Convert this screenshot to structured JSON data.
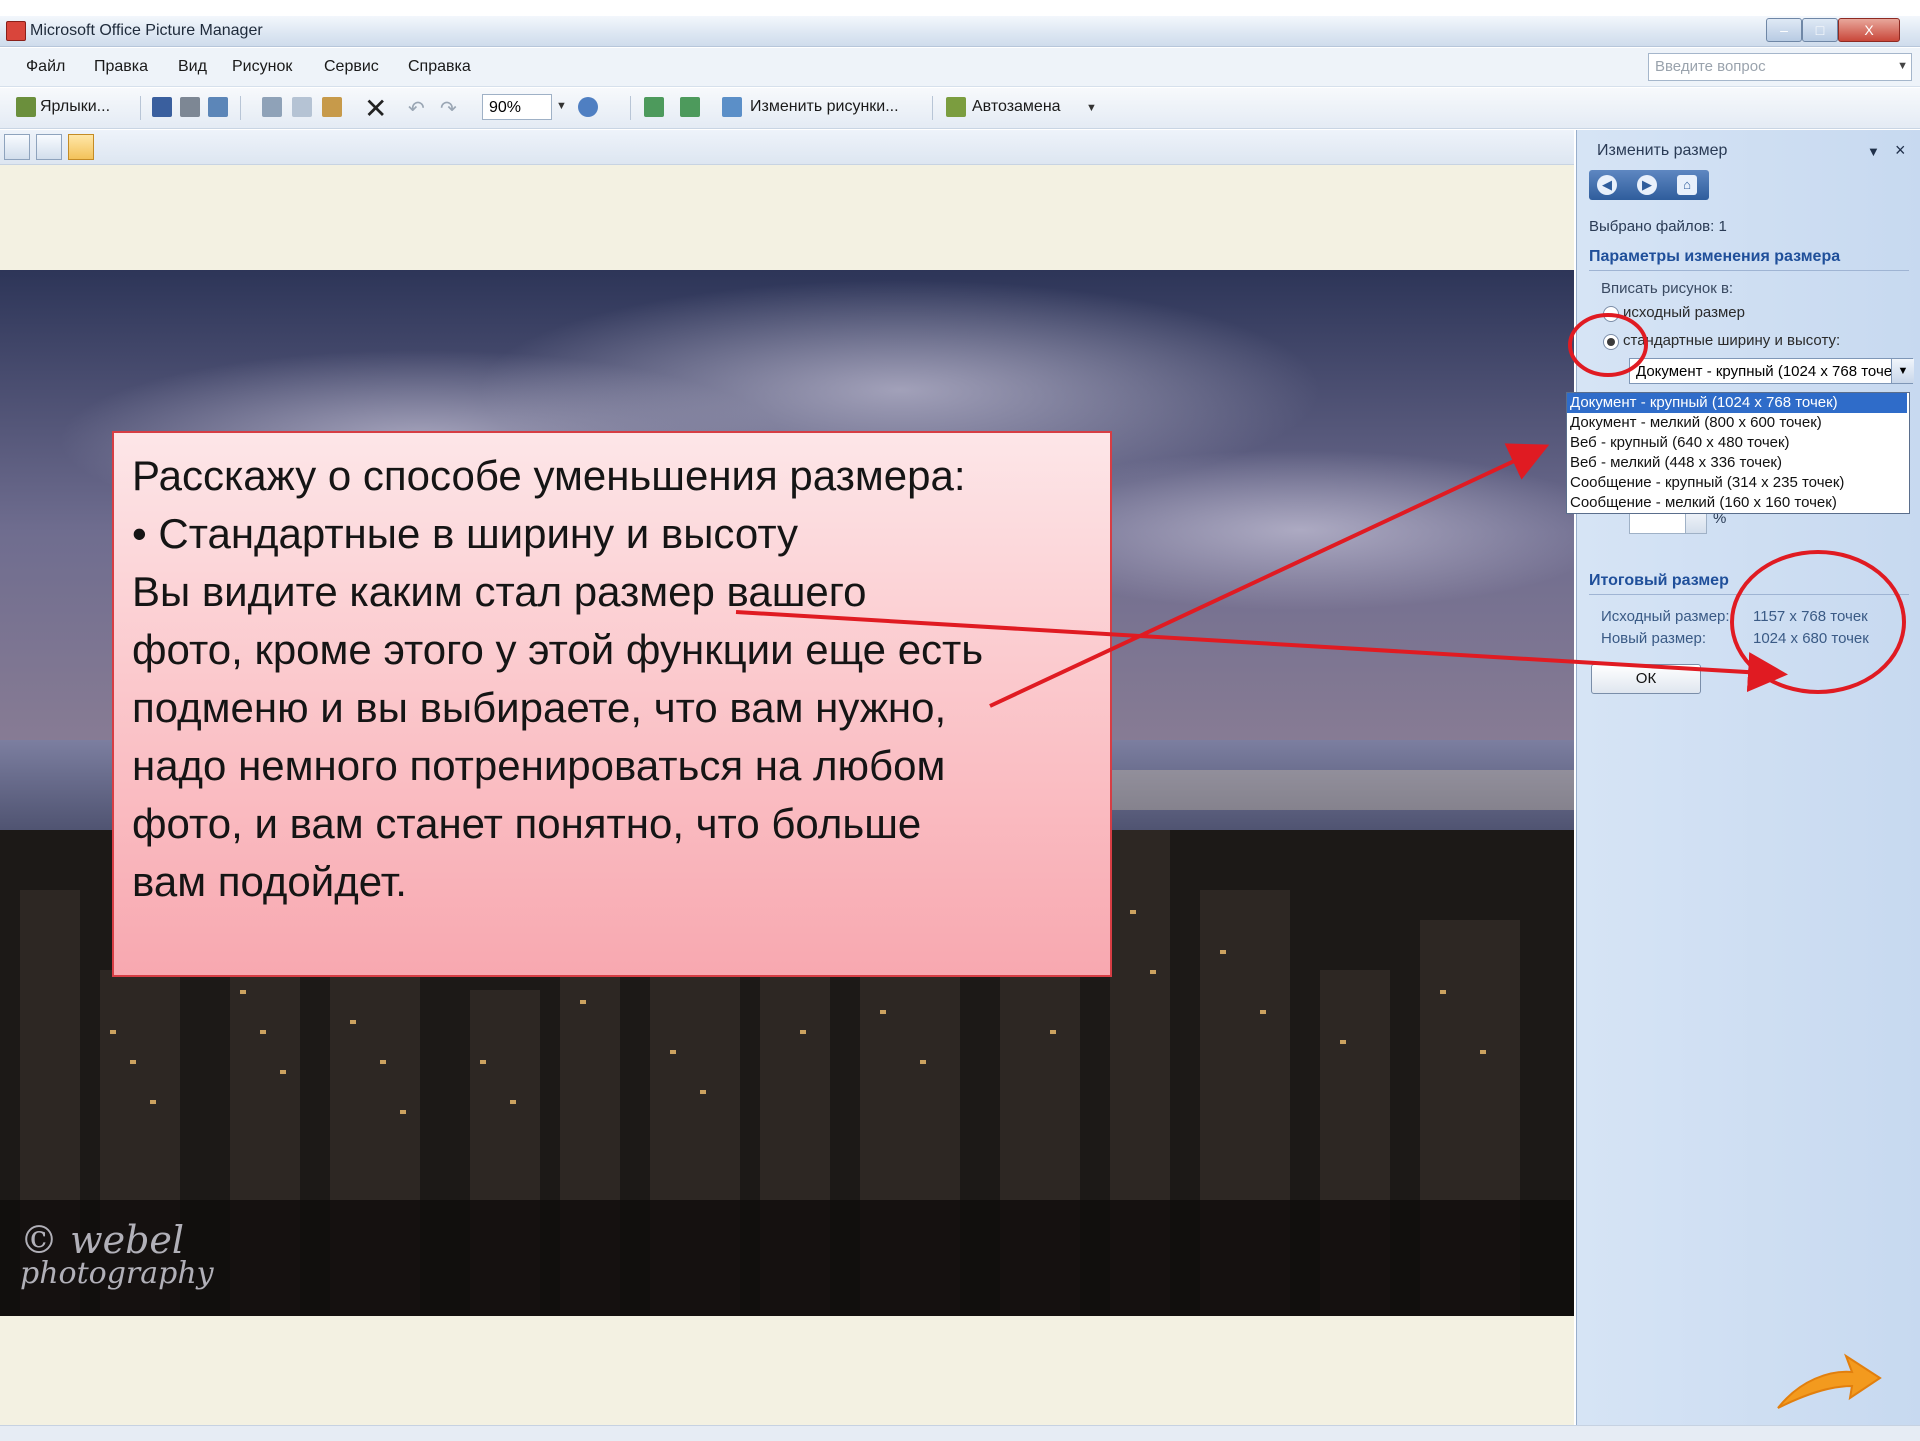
{
  "window": {
    "title": "Microsoft Office Picture Manager",
    "min_glyph": "–",
    "max_glyph": "□",
    "close_glyph": "X"
  },
  "menu": {
    "items": [
      "Файл",
      "Правка",
      "Вид",
      "Рисунок",
      "Сервис",
      "Справка"
    ],
    "help_placeholder": "Введите вопрос"
  },
  "toolbar": {
    "shortcuts_label": "Ярлыки...",
    "zoom_value": "90%",
    "edit_pictures_label": "Изменить рисунки...",
    "autocorrect_label": "Автозамена"
  },
  "callout": {
    "lines": [
      "Расскажу о  способе уменьшения размера:",
      "• Стандартные в ширину и высоту",
      "Вы видите каким стал размер вашего",
      "фото, кроме этого у этой функции еще есть",
      "подменю и вы выбираете, что вам нужно,",
      "надо немного потренироваться на любом",
      "фото, и вам станет понятно, что больше",
      "вам подойдет."
    ]
  },
  "watermark": {
    "line1": "© webel",
    "line2": "photography"
  },
  "pane": {
    "title": "Изменить размер",
    "dropdown_glyph": "▼",
    "close_glyph": "×",
    "files_selected": "Выбрано файлов: 1",
    "section_title": "Параметры изменения размера",
    "fit_label": "Вписать рисунок в:",
    "option_original": "исходный размер",
    "option_standard": "стандартные ширину и высоту:",
    "selected_size": "Документ - крупный (1024 x 768 точек)",
    "size_options": [
      "Документ - крупный (1024 x 768 точек)",
      "Документ - мелкий (800 x 600 точек)",
      "Веб - крупный (640 x 480 точек)",
      "Веб - мелкий (448 x 336 точек)",
      "Сообщение - крупный (314 x 235 точек)",
      "Сообщение - мелкий (160 x 160 точек)"
    ],
    "percent_sign": "%",
    "summary_title": "Итоговый размер",
    "original_label": "Исходный размер:",
    "original_value": "1157 x 768 точек",
    "new_label": "Новый размер:",
    "new_value": "1024 x 680 точек",
    "ok_label": "ОК"
  },
  "colors": {
    "accent": "#1f4f9a",
    "annotation_red": "#e01b22",
    "callout_border": "#d63d44",
    "arrow_orange": "#f39a1e"
  },
  "icons": [
    "app-icon",
    "shortcuts-icon",
    "save-icon",
    "print-icon",
    "cut-icon",
    "copy-icon",
    "paste-icon",
    "delete-icon",
    "undo-icon",
    "redo-icon",
    "help-icon",
    "rotate-left-icon",
    "rotate-right-icon",
    "edit-pictures-icon",
    "autocorrect-icon",
    "thumbnail-view-icon",
    "filmstrip-view-icon",
    "single-view-icon",
    "back-icon",
    "forward-icon",
    "home-icon",
    "next-arrow-icon"
  ]
}
